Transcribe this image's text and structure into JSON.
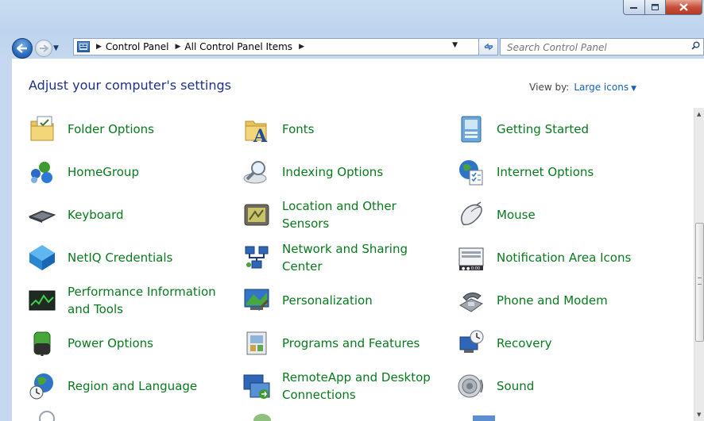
{
  "window": {
    "caption_buttons": [
      "minimize",
      "maximize",
      "close"
    ]
  },
  "navbar": {
    "breadcrumb": [
      "Control Panel",
      "All Control Panel Items"
    ],
    "search_placeholder": "Search Control Panel"
  },
  "content": {
    "heading": "Adjust your computer's settings",
    "view_by_label": "View by:",
    "view_by_value": "Large icons"
  },
  "items": [
    {
      "label": "Folder Options",
      "icon": "folder-options-icon"
    },
    {
      "label": "Fonts",
      "icon": "fonts-icon"
    },
    {
      "label": "Getting Started",
      "icon": "getting-started-icon"
    },
    {
      "label": "HomeGroup",
      "icon": "homegroup-icon"
    },
    {
      "label": "Indexing Options",
      "icon": "indexing-options-icon"
    },
    {
      "label": "Internet Options",
      "icon": "internet-options-icon"
    },
    {
      "label": "Keyboard",
      "icon": "keyboard-icon"
    },
    {
      "label": "Location and Other Sensors",
      "icon": "location-sensors-icon"
    },
    {
      "label": "Mouse",
      "icon": "mouse-icon"
    },
    {
      "label": "NetIQ Credentials",
      "icon": "netiq-credentials-icon"
    },
    {
      "label": "Network and Sharing Center",
      "icon": "network-sharing-icon"
    },
    {
      "label": "Notification Area Icons",
      "icon": "notification-area-icon"
    },
    {
      "label": "Performance Information and Tools",
      "icon": "performance-icon"
    },
    {
      "label": "Personalization",
      "icon": "personalization-icon"
    },
    {
      "label": "Phone and Modem",
      "icon": "phone-modem-icon"
    },
    {
      "label": "Power Options",
      "icon": "power-options-icon"
    },
    {
      "label": "Programs and Features",
      "icon": "programs-features-icon"
    },
    {
      "label": "Recovery",
      "icon": "recovery-icon"
    },
    {
      "label": "Region and Language",
      "icon": "region-language-icon"
    },
    {
      "label": "RemoteApp and Desktop Connections",
      "icon": "remoteapp-icon"
    },
    {
      "label": "Sound",
      "icon": "sound-icon"
    }
  ],
  "colors": {
    "item_link": "#087a1d",
    "heading": "#1e3287",
    "view_link": "#1561b3"
  }
}
